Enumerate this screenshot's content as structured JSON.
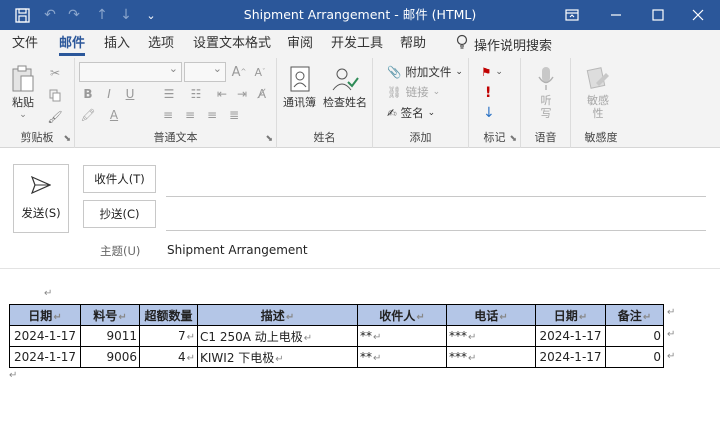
{
  "window": {
    "title": "Shipment Arrangement  -  邮件 (HTML)",
    "accent": "#2b579a"
  },
  "tabs": [
    "文件",
    "邮件",
    "插入",
    "选项",
    "设置文本格式",
    "审阅",
    "开发工具",
    "帮助"
  ],
  "active_tab": "邮件",
  "tell_me": "操作说明搜索",
  "ribbon": {
    "clipboard": {
      "paste": "粘贴",
      "label": "剪贴板"
    },
    "basic_text": {
      "label": "普通文本",
      "font_size_up": "A",
      "font_size_down": "A"
    },
    "names": {
      "address_book": "通讯簿",
      "check_names": "检查姓名",
      "label": "姓名"
    },
    "include": {
      "attach_file": "附加文件",
      "link": "链接",
      "signature": "签名",
      "label": "添加"
    },
    "tags": {
      "label": "标记"
    },
    "voice": {
      "dictate": "听写",
      "label": "语音"
    },
    "sensitivity": {
      "btn": "敏感性",
      "label": "敏感度"
    }
  },
  "compose": {
    "send": "发送(S)",
    "to": "收件人(T)",
    "cc": "抄送(C)",
    "subject_label": "主题(U)",
    "subject": "Shipment Arrangement"
  },
  "table": {
    "header_bg": "#b4c6e7",
    "headers": [
      "日期",
      "料号",
      "超额数量",
      "描述",
      "收件人",
      "电话",
      "日期",
      "备注"
    ],
    "rows": [
      [
        "2024-1-17",
        "9011",
        "7",
        "C1 250A 动上电极",
        "**",
        "***",
        "2024-1-17",
        "0"
      ],
      [
        "2024-1-17",
        "9006",
        "4",
        "KIWI2 下电极",
        "**",
        "***",
        "2024-1-17",
        "0"
      ]
    ]
  }
}
